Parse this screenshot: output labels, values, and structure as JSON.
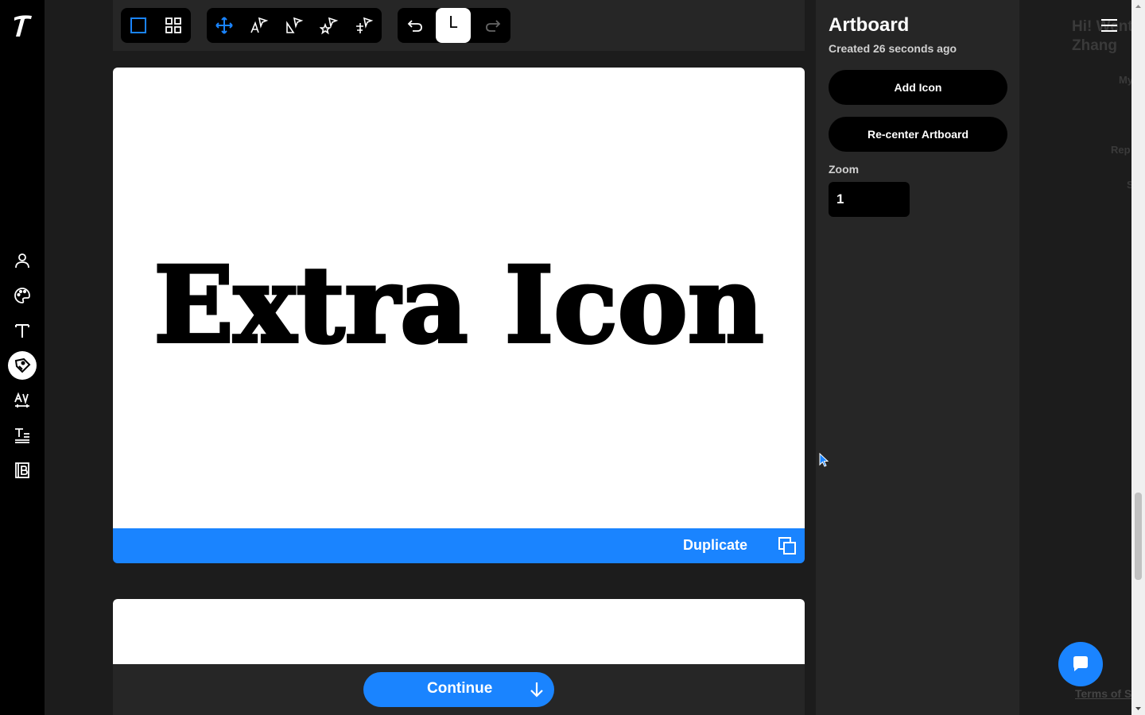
{
  "rail": {
    "logo_glyph": "T",
    "items": [
      {
        "name": "account-icon"
      },
      {
        "name": "palette-icon"
      },
      {
        "name": "type-icon"
      },
      {
        "name": "pen-tag-icon",
        "active": true
      },
      {
        "name": "kerning-icon"
      },
      {
        "name": "text-style-icon"
      },
      {
        "name": "glyph-book-icon"
      }
    ]
  },
  "toolbar": {
    "undo_key": "L"
  },
  "artboard": {
    "text": "Extra Icon",
    "duplicate_label": "Duplicate"
  },
  "bottom": {
    "continue_label": "Continue"
  },
  "panel": {
    "title": "Artboard",
    "subtitle": "Created 26 seconds ago",
    "add_icon_label": "Add Icon",
    "recenter_label": "Re-center Artboard",
    "zoom_label": "Zoom",
    "zoom_value": "1"
  },
  "far": {
    "greeting_line1": "Hi! Went",
    "greeting_line2": "Zhang",
    "faint1": "My",
    "faint2": "Rep",
    "faint3": "S",
    "terms": "Terms of S"
  },
  "colors": {
    "accent": "#1a84ff",
    "panel": "#262626",
    "canvas": "#1c1c1c"
  }
}
